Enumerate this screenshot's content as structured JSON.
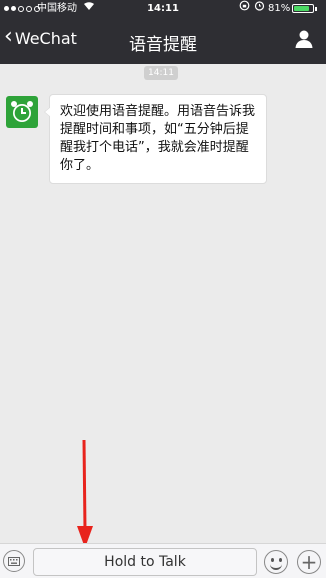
{
  "status_bar": {
    "carrier": "中国移动",
    "time": "14:11",
    "battery_percent": "81%",
    "battery_level": 0.81,
    "icons": [
      "signal-dots",
      "wifi-icon",
      "lock-rotation-icon",
      "alarm-icon",
      "battery-icon"
    ]
  },
  "nav": {
    "back_label": "WeChat",
    "title": "语音提醒",
    "right_icon": "person-icon"
  },
  "chat": {
    "timestamp": "14:11",
    "message": {
      "avatar_icon": "alarm-clock-icon",
      "text": "欢迎使用语音提醒。用语音告诉我提醒时间和事项，如“五分钟后提醒我打个电话”，我就会准时提醒你了。"
    }
  },
  "toolbar": {
    "keyboard_icon": "keyboard-icon",
    "hold_to_talk_label": "Hold to Talk",
    "emoji_icon": "emoji-icon",
    "plus_icon": "plus-icon"
  },
  "annotation": {
    "arrow_color": "#e8231c",
    "target": "hold-to-talk-button"
  },
  "colors": {
    "nav_background": "#2e2e33",
    "chat_background": "#ebebeb",
    "avatar_green": "#2ea339",
    "battery_green": "#4cd964"
  }
}
